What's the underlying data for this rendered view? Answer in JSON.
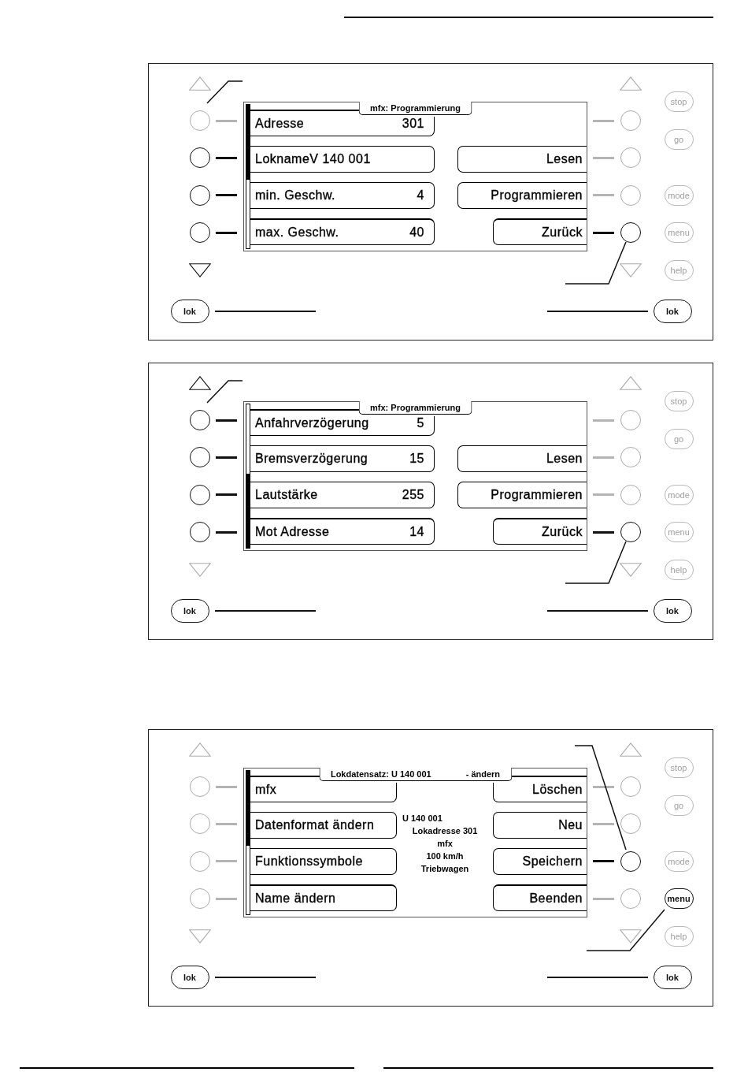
{
  "panels": [
    {
      "screen": {
        "title": [
          "mfx: Programmierung"
        ],
        "scrollbar": {
          "at_bottom": false
        },
        "left_keys": [
          {
            "label": "Adresse",
            "value": "301",
            "active": false
          },
          {
            "label": "LoknameV 140 001",
            "active": true
          },
          {
            "label": "min. Geschw.",
            "value": "4",
            "active": true
          },
          {
            "label": "max. Geschw.",
            "value": "40",
            "active": true
          }
        ],
        "right_keys": [
          {
            "kind": "empty",
            "active": false
          },
          {
            "kind": "wide",
            "label": "Lesen",
            "active": false
          },
          {
            "kind": "wide",
            "label": "Programmieren",
            "active": false
          },
          {
            "kind": "narrow",
            "label": "Zurück",
            "active": true
          }
        ]
      },
      "left_arrows": {
        "up": {
          "active": false
        },
        "down": {
          "active": true
        }
      },
      "right_arrows": {
        "up": {
          "active": false
        },
        "down": {
          "active": false
        }
      },
      "side_buttons": [
        {
          "label": "stop",
          "active": false
        },
        {
          "label": "go",
          "active": false
        },
        {
          "label": "mode",
          "active": false
        },
        {
          "label": "menu",
          "active": false
        },
        {
          "label": "help",
          "active": false
        }
      ],
      "lok_buttons": [
        {
          "label": "lok"
        },
        {
          "label": "lok"
        }
      ],
      "leaders": [
        {
          "kind": "upper_left"
        },
        {
          "kind": "lower_right"
        }
      ]
    },
    {
      "screen": {
        "title": [
          "mfx: Programmierung"
        ],
        "scrollbar": {
          "at_bottom": true
        },
        "left_keys": [
          {
            "label": "Anfahrverzögerung",
            "value": "5",
            "active": true
          },
          {
            "label": "Bremsverzögerung",
            "value": "15",
            "active": true
          },
          {
            "label": "Lautstärke",
            "value": "255",
            "active": true
          },
          {
            "label": "Mot Adresse",
            "value": "14",
            "active": true
          }
        ],
        "right_keys": [
          {
            "kind": "empty",
            "active": false
          },
          {
            "kind": "wide",
            "label": "Lesen",
            "active": false
          },
          {
            "kind": "wide",
            "label": "Programmieren",
            "active": false
          },
          {
            "kind": "narrow",
            "label": "Zurück",
            "active": true
          }
        ]
      },
      "left_arrows": {
        "up": {
          "active": true
        },
        "down": {
          "active": false
        }
      },
      "right_arrows": {
        "up": {
          "active": false
        },
        "down": {
          "active": false
        }
      },
      "side_buttons": [
        {
          "label": "stop",
          "active": false
        },
        {
          "label": "go",
          "active": false
        },
        {
          "label": "mode",
          "active": false
        },
        {
          "label": "menu",
          "active": false
        },
        {
          "label": "help",
          "active": false
        }
      ],
      "lok_buttons": [
        {
          "label": "lok"
        },
        {
          "label": "lok"
        }
      ],
      "leaders": [
        {
          "kind": "upper_left"
        },
        {
          "kind": "lower_right"
        }
      ]
    },
    {
      "screen": {
        "title": [
          "Lokdatensatz: U 140 001",
          "- ändern"
        ],
        "scrollbar": {
          "at_bottom": false
        },
        "left_keys": [
          {
            "label": "mfx",
            "active": false
          },
          {
            "label": "Datenformat ändern",
            "active": false
          },
          {
            "label": "Funktionssymbole",
            "active": false
          },
          {
            "label": "Name ändern",
            "active": false
          }
        ],
        "info": {
          "name": "U 140 001",
          "lines": [
            "Lokadresse 301",
            "mfx",
            "100 km/h",
            "Triebwagen"
          ]
        },
        "right_keys": [
          {
            "kind": "narrow",
            "label": "Löschen",
            "active": false
          },
          {
            "kind": "narrow",
            "label": "Neu",
            "active": false
          },
          {
            "kind": "narrow",
            "label": "Speichern",
            "active": true
          },
          {
            "kind": "narrow",
            "label": "Beenden",
            "active": false
          }
        ]
      },
      "left_arrows": {
        "up": {
          "active": false
        },
        "down": {
          "active": false
        }
      },
      "right_arrows": {
        "up": {
          "active": false
        },
        "down": {
          "active": false
        }
      },
      "side_buttons": [
        {
          "label": "stop",
          "active": false
        },
        {
          "label": "go",
          "active": false
        },
        {
          "label": "mode",
          "active": false
        },
        {
          "label": "menu",
          "active": true
        },
        {
          "label": "help",
          "active": false
        }
      ],
      "lok_buttons": [
        {
          "label": "lok"
        },
        {
          "label": "lok"
        }
      ],
      "leaders": [
        {
          "kind": "upper_right"
        },
        {
          "kind": "menu"
        }
      ]
    }
  ]
}
